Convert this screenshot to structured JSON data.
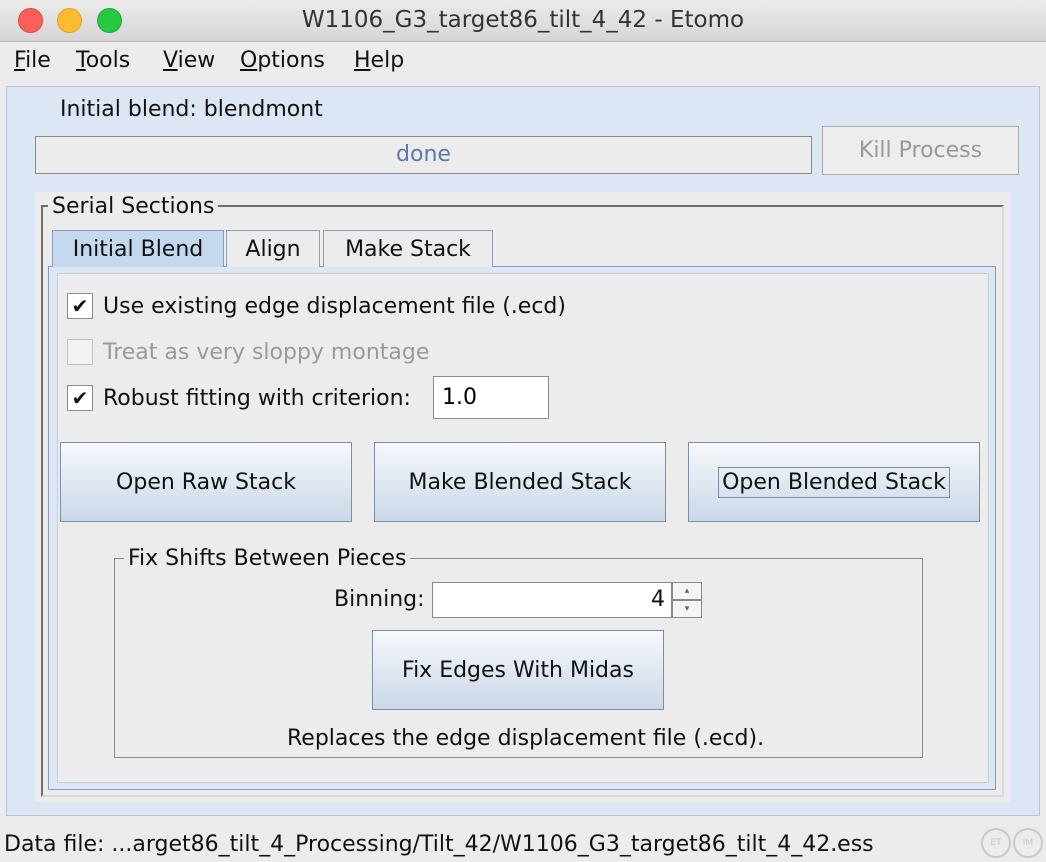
{
  "window": {
    "title": "W1106_G3_target86_tilt_4_42 - Etomo"
  },
  "menubar": {
    "items": [
      {
        "mnemonic": "F",
        "rest": "ile"
      },
      {
        "mnemonic": "T",
        "rest": "ools"
      },
      {
        "mnemonic": "V",
        "rest": "iew"
      },
      {
        "mnemonic": "O",
        "rest": "ptions"
      },
      {
        "mnemonic": "H",
        "rest": "elp"
      }
    ]
  },
  "process": {
    "label": "Initial blend: blendmont",
    "status": "done",
    "kill_button": "Kill Process"
  },
  "serial_sections": {
    "legend": "Serial Sections",
    "tabs": [
      "Initial Blend",
      "Align",
      "Make Stack"
    ],
    "active_tab": "Initial Blend"
  },
  "initial_blend": {
    "use_ecd": {
      "label": "Use existing edge displacement file (.ecd)",
      "checked": true,
      "check_glyph": "✔"
    },
    "sloppy": {
      "label": "Treat as very sloppy montage",
      "checked": false,
      "enabled": false
    },
    "robust": {
      "label": "Robust fitting with criterion:",
      "checked": true,
      "check_glyph": "✔",
      "value": "1.0"
    },
    "buttons": {
      "open_raw": "Open Raw Stack",
      "make_blended": "Make Blended Stack",
      "open_blended": "Open Blended Stack"
    }
  },
  "fix_shifts": {
    "legend": "Fix Shifts Between Pieces",
    "binning_label": "Binning:",
    "binning_value": "4",
    "spin_up": "▴",
    "spin_down": "▾",
    "fix_button": "Fix Edges With Midas",
    "note": "Replaces the edge displacement file (.ecd)."
  },
  "statusbar": {
    "text": "Data file: ...arget86_tilt_4_Processing/Tilt_42/W1106_G3_target86_tilt_4_42.ess",
    "icons": [
      "ET",
      "IM"
    ]
  }
}
